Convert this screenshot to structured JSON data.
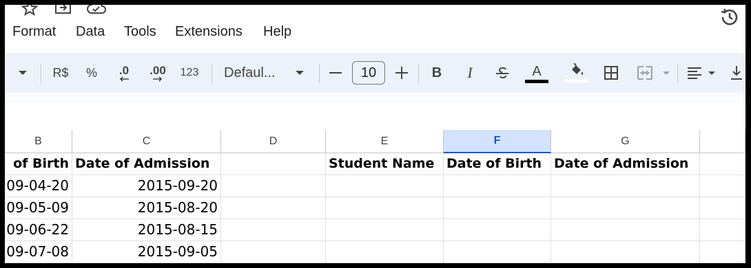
{
  "menu": {
    "format": "Format",
    "data": "Data",
    "tools": "Tools",
    "extensions": "Extensions",
    "help": "Help"
  },
  "toolbar": {
    "currency": "R$",
    "percent": "%",
    "decrease_decimal": ".0",
    "increase_decimal": ".00",
    "more_formats": "123",
    "font": "Defaul...",
    "font_size": "10",
    "bold": "B",
    "italic": "I",
    "text_color": "A",
    "text_color_bar": "#000000"
  },
  "columns": {
    "b": "B",
    "c": "C",
    "d": "D",
    "e": "E",
    "f": "F",
    "g": "G"
  },
  "sheet": {
    "header_row": {
      "b": "of Birth",
      "c": "Date of Admission",
      "e": "Student Name",
      "f": "Date of Birth",
      "g": "Date of Admission"
    },
    "rows": [
      {
        "b": "09-04-20",
        "c": "2015-09-20"
      },
      {
        "b": "09-05-09",
        "c": "2015-08-20"
      },
      {
        "b": "09-06-22",
        "c": "2015-08-15"
      },
      {
        "b": "09-07-08",
        "c": "2015-09-05"
      }
    ]
  },
  "colors": {
    "toolbar_bg": "#edf2fa",
    "selected_col_bg": "#d3e3fd",
    "selected_col_text": "#0b57d0"
  }
}
